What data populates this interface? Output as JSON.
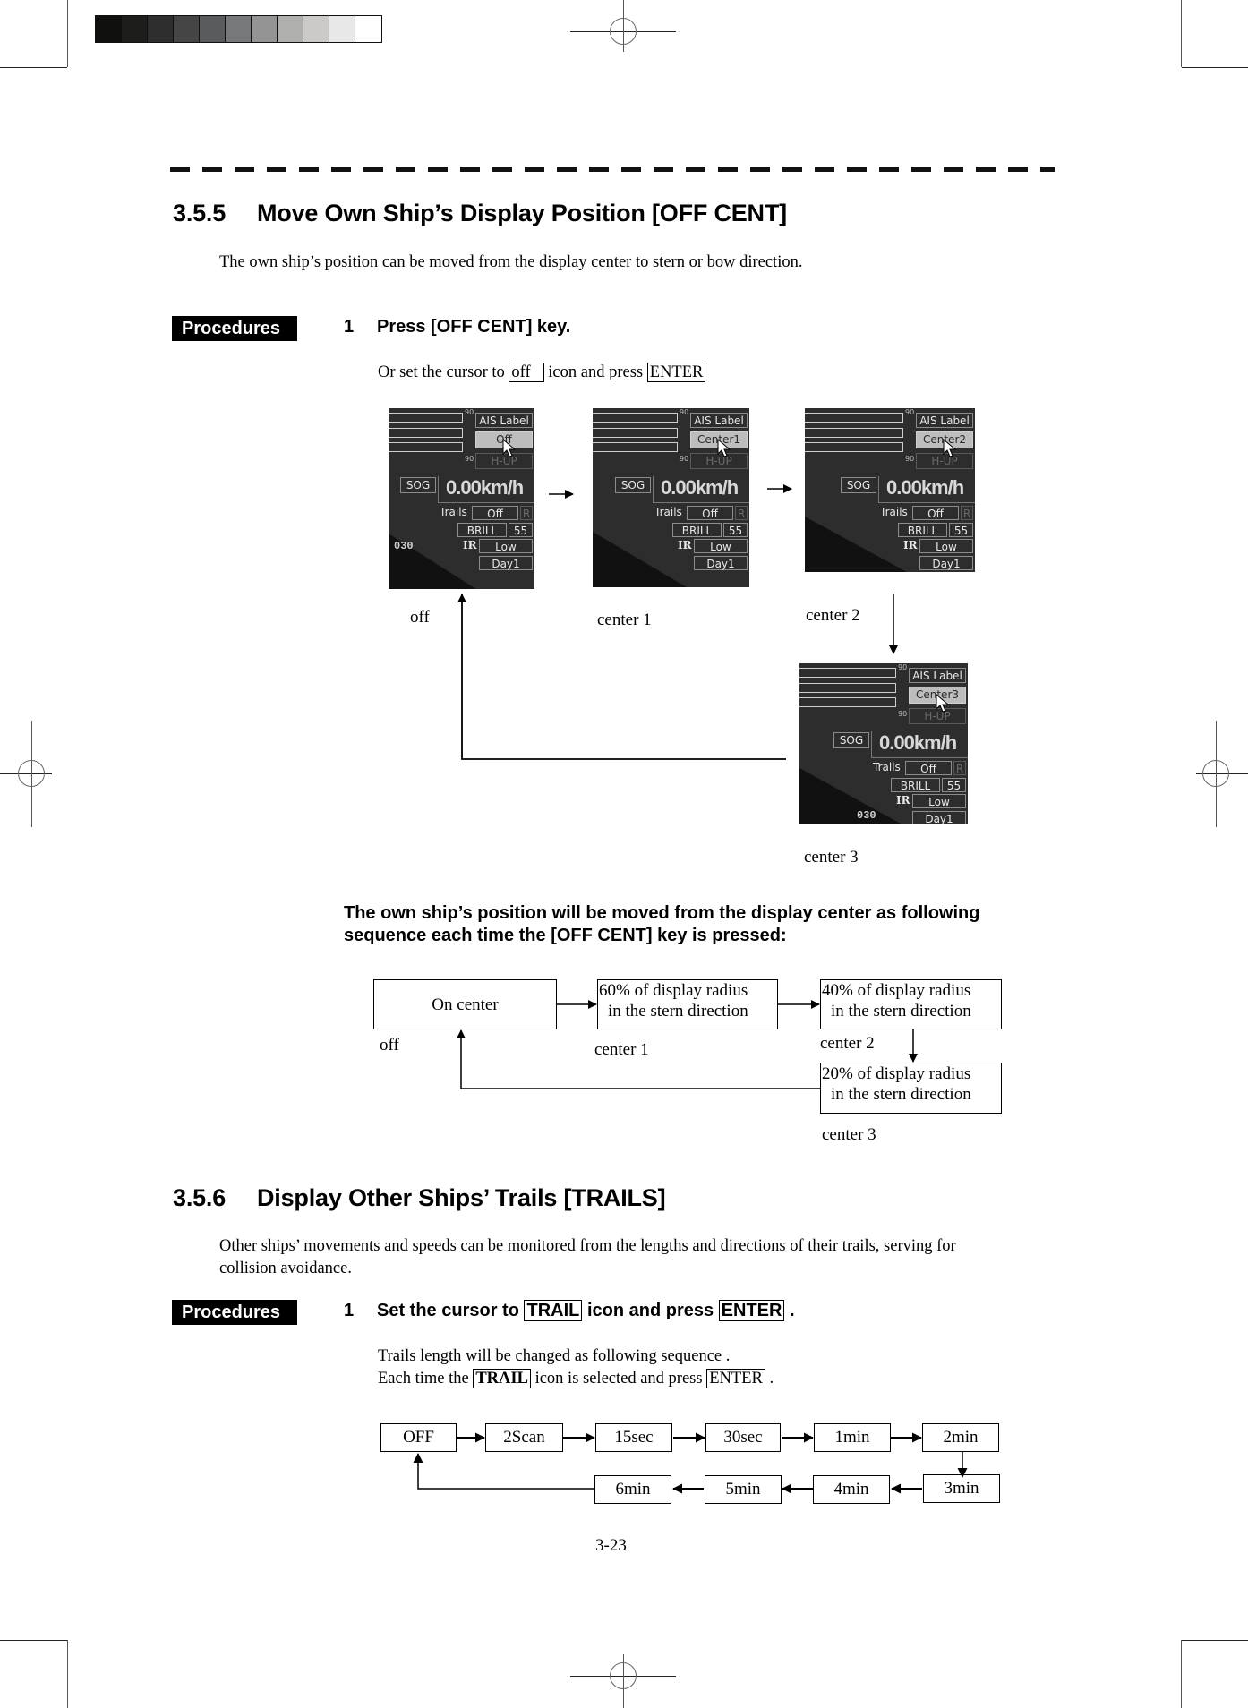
{
  "print_marks": {
    "grayscale_swatches": [
      "#0f0f0d",
      "#1d1d1b",
      "#2d2d2d",
      "#454545",
      "#5a5b5d",
      "#77787a",
      "#949494",
      "#afafae",
      "#cbcac8",
      "#e8e8e8",
      "#ffffff"
    ]
  },
  "section_355": {
    "number": "3.5.5",
    "title": "Move Own Ship’s Display Position [OFF CENT]",
    "intro": "The own ship’s position can be moved from the display center to stern or bow direction.",
    "procedures_label": "Procedures",
    "step1": {
      "number": "1",
      "text": "Press [OFF CENT] key.",
      "sub_pre": "Or set the cursor to",
      "sub_key1": "off",
      "sub_mid": "icon and press",
      "sub_key2": "ENTER"
    },
    "screens": [
      {
        "caption": "off",
        "mode_button": "Off",
        "bearing": "030"
      },
      {
        "caption": "center 1",
        "mode_button": "Center1",
        "bearing": ""
      },
      {
        "caption": "center 2",
        "mode_button": "Center2",
        "bearing": ""
      },
      {
        "caption": "center 3",
        "mode_button": "Center3",
        "bearing": "030"
      }
    ],
    "screen_common": {
      "scale_label": "90",
      "ais_label": "AIS Label",
      "orientation": "H-UP",
      "sog_label": "SOG",
      "speed": "0.00km/h",
      "trails_label": "Trails",
      "trails_value": "Off",
      "trails_r": "R",
      "brill_label": "BRILL",
      "brill_value": "55",
      "ir_label": "IR",
      "ir_value": "Low",
      "day_value": "Day1"
    },
    "sequence_note_line1": "The own ship’s position will be moved from the display center as following",
    "sequence_note_line2": "sequence each time the [OFF CENT] key is pressed:",
    "flow": [
      {
        "box_line1": "On center",
        "box_line2": "",
        "label": "off"
      },
      {
        "box_line1": "60% of display radius",
        "box_line2": "in the stern direction",
        "label": "center 1"
      },
      {
        "box_line1": "40% of display radius",
        "box_line2": "in the stern direction",
        "label": "center 2"
      },
      {
        "box_line1": "20% of display radius",
        "box_line2": "in the stern direction",
        "label": "center 3"
      }
    ]
  },
  "section_356": {
    "number": "3.5.6",
    "title": "Display Other Ships’ Trails [TRAILS]",
    "intro_line1": "Other ships’ movements and speeds can be monitored from the lengths and directions of their trails, serving for",
    "intro_line2": "collision avoidance.",
    "procedures_label": "Procedures",
    "step1": {
      "number": "1",
      "pre": "Set the cursor to",
      "key1": "TRAIL",
      "mid": "icon and press",
      "key2": "ENTER",
      "post": "."
    },
    "note_line1": "Trails length will be changed as following sequence .",
    "note_line2_pre": "Each time the",
    "note_line2_key1": "TRAIL",
    "note_line2_mid": "icon is selected and press",
    "note_line2_key2": "ENTER",
    "note_line2_post": ".",
    "trail_sequence_row1": [
      "OFF",
      "2Scan",
      "15sec",
      "30sec",
      "1min",
      "2min"
    ],
    "trail_sequence_row2": [
      "6min",
      "5min",
      "4min",
      "3min"
    ]
  },
  "page_number": "3-23"
}
